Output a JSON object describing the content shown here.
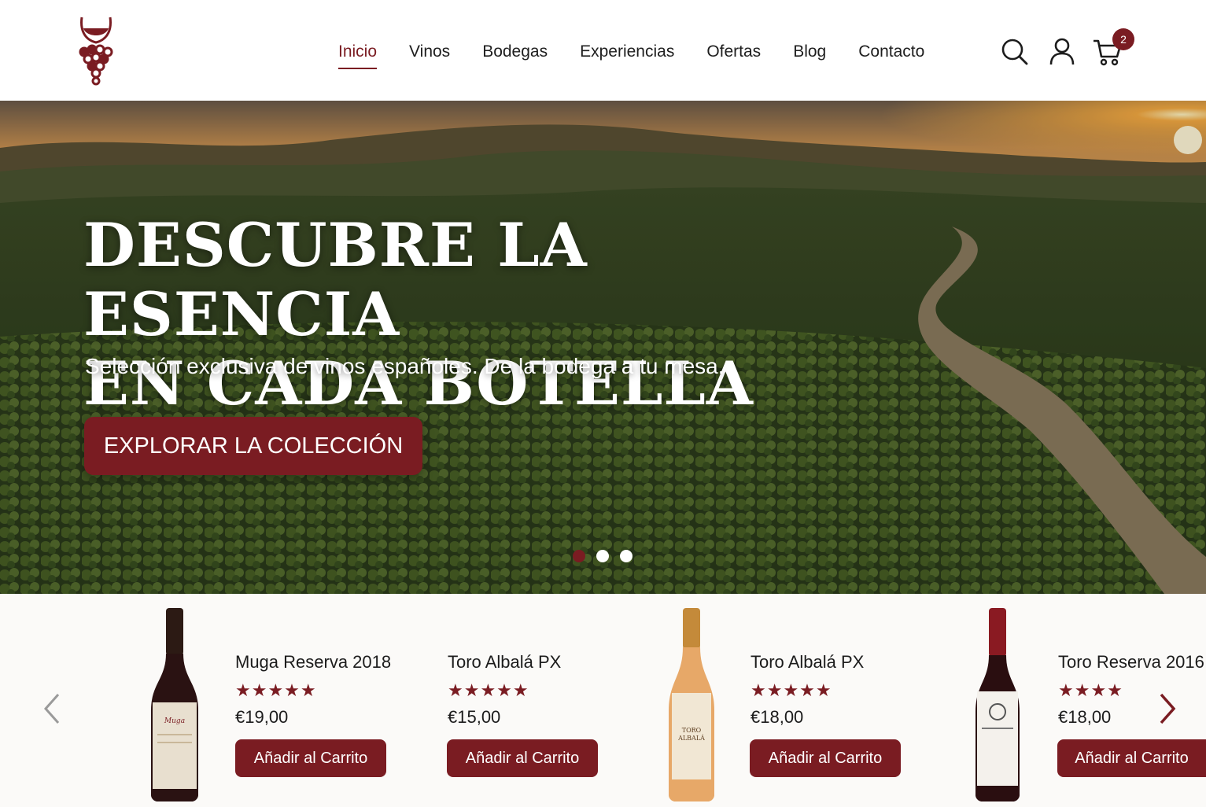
{
  "header": {
    "logo_icon": "wine-glass-grapes-icon",
    "nav": [
      {
        "label": "Inicio",
        "active": true
      },
      {
        "label": "Vinos"
      },
      {
        "label": "Bodegas"
      },
      {
        "label": "Experiencias"
      },
      {
        "label": "Ofertas"
      },
      {
        "label": "Blog"
      },
      {
        "label": "Contacto"
      }
    ],
    "cart_count": "2",
    "icons": [
      "search-icon",
      "user-icon",
      "cart-icon"
    ]
  },
  "hero": {
    "title_line1": "DESCUBRE LA ESENCIA",
    "title_line2": "EN CADA BOTELLA",
    "subtitle": "Selección exclusiva de vinos españoles. De la bodega a tu mesa.",
    "cta": "EXPLORAR LA COLECCIÓN",
    "slides": 3,
    "active_slide": 1
  },
  "products": [
    {
      "name": "Muga Reserva 2018",
      "stars": "★★★★★",
      "rating": 5,
      "price": "€19,00",
      "button": "Añadir al Carrito",
      "bottle": "red"
    },
    {
      "name": "Toro Albalá PX",
      "stars": "★★★★★",
      "rating": 5,
      "price": "€15,00",
      "button": "Añadir al Carrito",
      "bottle": "none"
    },
    {
      "name": "Toro Albalá PX",
      "stars": "★★★★★",
      "rating": 5,
      "price": "€18,00",
      "button": "Añadir al Carrito",
      "bottle": "amber"
    },
    {
      "name": "Toro Reserva 2016",
      "stars": "★★★★",
      "rating": 4,
      "price": "€18,00",
      "button": "Añadir al Carrito",
      "bottle": "red-cap"
    }
  ],
  "colors": {
    "brand": "#7a1c22",
    "text": "#1c1c1c",
    "background": "#fbfaf8"
  }
}
